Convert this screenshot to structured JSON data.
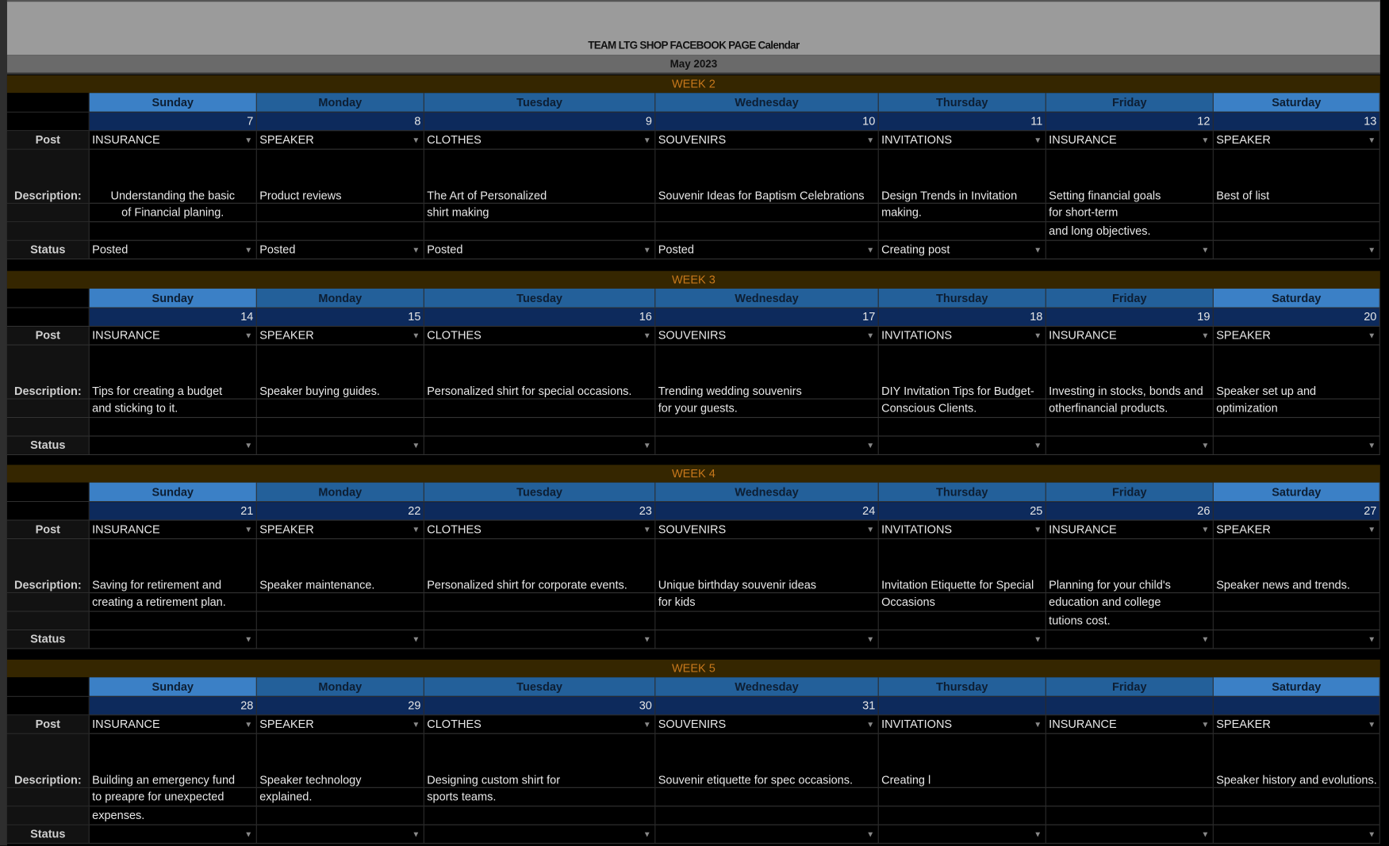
{
  "title": "TEAM LTG SHOP FACEBOOK PAGE Calendar",
  "month": "May 2023",
  "labels": {
    "post": "Post",
    "description": "Description:",
    "status": "Status"
  },
  "days": [
    "Sunday",
    "Monday",
    "Tuesday",
    "Wednesday",
    "Thursday",
    "Friday",
    "Saturday"
  ],
  "colors": {
    "week_bg": "#352600",
    "week_text": "#c7781b",
    "day_header": "#23609a",
    "weekend_header": "#3b80c6",
    "date_row": "#0d2a5c"
  },
  "weeks": [
    {
      "label": "WEEK 2",
      "dates": [
        "7",
        "8",
        "9",
        "10",
        "11",
        "12",
        "13"
      ],
      "posts": [
        "INSURANCE",
        "SPEAKER",
        "CLOTHES",
        "SOUVENIRS",
        "INVITATIONS",
        "INSURANCE",
        "SPEAKER"
      ],
      "descriptions": [
        [
          "Understanding the basic",
          "of Financial planing.",
          ""
        ],
        [
          "Product reviews",
          "",
          ""
        ],
        [
          "The Art of Personalized",
          "shirt making",
          ""
        ],
        [
          "Souvenir Ideas for Baptism Celebrations",
          "",
          ""
        ],
        [
          "Design Trends in Invitation",
          "making.",
          ""
        ],
        [
          "Setting financial goals",
          "for short-term",
          "and long objectives."
        ],
        [
          "Best of list",
          "",
          ""
        ]
      ],
      "status": [
        "Posted",
        "Posted",
        "Posted",
        "Posted",
        "Creating post",
        "",
        ""
      ]
    },
    {
      "label": "WEEK 3",
      "dates": [
        "14",
        "15",
        "16",
        "17",
        "18",
        "19",
        "20"
      ],
      "posts": [
        "INSURANCE",
        "SPEAKER",
        "CLOTHES",
        "SOUVENIRS",
        "INVITATIONS",
        "INSURANCE",
        "SPEAKER"
      ],
      "descriptions": [
        [
          "Tips for creating a budget",
          "and sticking to it.",
          ""
        ],
        [
          "Speaker buying guides.",
          "",
          ""
        ],
        [
          "Personalized shirt for special occasions.",
          "",
          ""
        ],
        [
          "Trending wedding souvenirs",
          "for your guests.",
          ""
        ],
        [
          "DIY Invitation Tips for Budget-",
          "Conscious Clients.",
          ""
        ],
        [
          "Investing in stocks, bonds and",
          "otherfinancial products.",
          ""
        ],
        [
          "Speaker set up and",
          "optimization",
          ""
        ]
      ],
      "status": [
        "",
        "",
        "",
        "",
        "",
        "",
        ""
      ]
    },
    {
      "label": "WEEK 4",
      "dates": [
        "21",
        "22",
        "23",
        "24",
        "25",
        "26",
        "27"
      ],
      "posts": [
        "INSURANCE",
        "SPEAKER",
        "CLOTHES",
        "SOUVENIRS",
        "INVITATIONS",
        "INSURANCE",
        "SPEAKER"
      ],
      "descriptions": [
        [
          "Saving for retirement and",
          "creating a retirement plan.",
          ""
        ],
        [
          "Speaker maintenance.",
          "",
          ""
        ],
        [
          "Personalized shirt for corporate events.",
          "",
          ""
        ],
        [
          "Unique  birthday souvenir ideas",
          "for kids",
          ""
        ],
        [
          "Invitation Etiquette for Special",
          "Occasions",
          ""
        ],
        [
          "Planning for your child's",
          "education and college",
          "tutions cost."
        ],
        [
          "Speaker news and trends.",
          "",
          ""
        ]
      ],
      "status": [
        "",
        "",
        "",
        "",
        "",
        "",
        ""
      ]
    },
    {
      "label": "WEEK 5",
      "dates": [
        "28",
        "29",
        "30",
        "31",
        "",
        "",
        ""
      ],
      "posts": [
        "INSURANCE",
        "SPEAKER",
        "CLOTHES",
        "SOUVENIRS",
        "INVITATIONS",
        "INSURANCE",
        "SPEAKER"
      ],
      "descriptions": [
        [
          "Building an emergency fund",
          "to preapre for unexpected",
          "expenses."
        ],
        [
          "Speaker technology",
          "explained.",
          ""
        ],
        [
          "Designing custom shirt for",
          "sports teams.",
          ""
        ],
        [
          "Souvenir etiquette for spec occasions.",
          "",
          ""
        ],
        [
          "Creating l",
          "",
          ""
        ],
        [
          "",
          "",
          ""
        ],
        [
          "Speaker history and evolutions.",
          "",
          ""
        ]
      ],
      "status": [
        "",
        "",
        "",
        "",
        "",
        "",
        ""
      ]
    }
  ]
}
